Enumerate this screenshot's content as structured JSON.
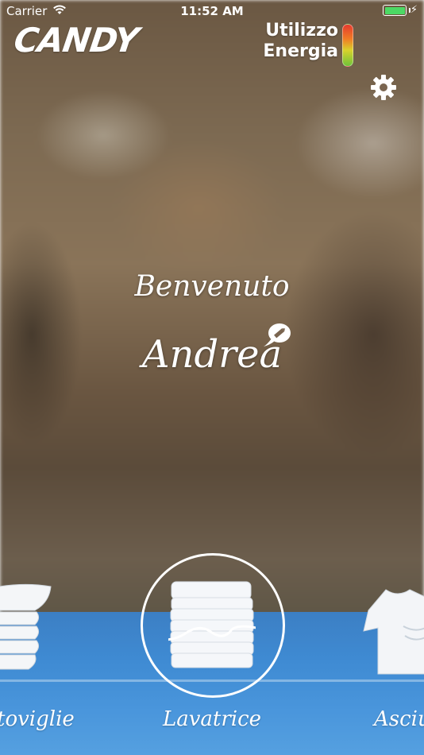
{
  "status_bar": {
    "carrier": "Carrier",
    "time": "11:52 AM",
    "battery_color": "#4cd964"
  },
  "header": {
    "logo_text": "CANDY",
    "energy_label_line1": "Utilizzo",
    "energy_label_line2": "Energia",
    "settings_icon": "gear-icon"
  },
  "greeting": {
    "welcome": "Benvenuto",
    "name": "Andrea",
    "edit_icon": "pencil-bubble-icon"
  },
  "carousel": {
    "items": [
      {
        "label": "toviglie",
        "icon": "bowls-icon"
      },
      {
        "label": "Lavatrice",
        "icon": "laundry-stack-icon",
        "selected": true
      },
      {
        "label": "Asciug",
        "icon": "shirt-icon"
      }
    ]
  },
  "colors": {
    "floor_blue": "#3f8bd3",
    "energy_gradient": [
      "#e53a2d",
      "#f07d25",
      "#d8d22c",
      "#6fc23a"
    ]
  }
}
